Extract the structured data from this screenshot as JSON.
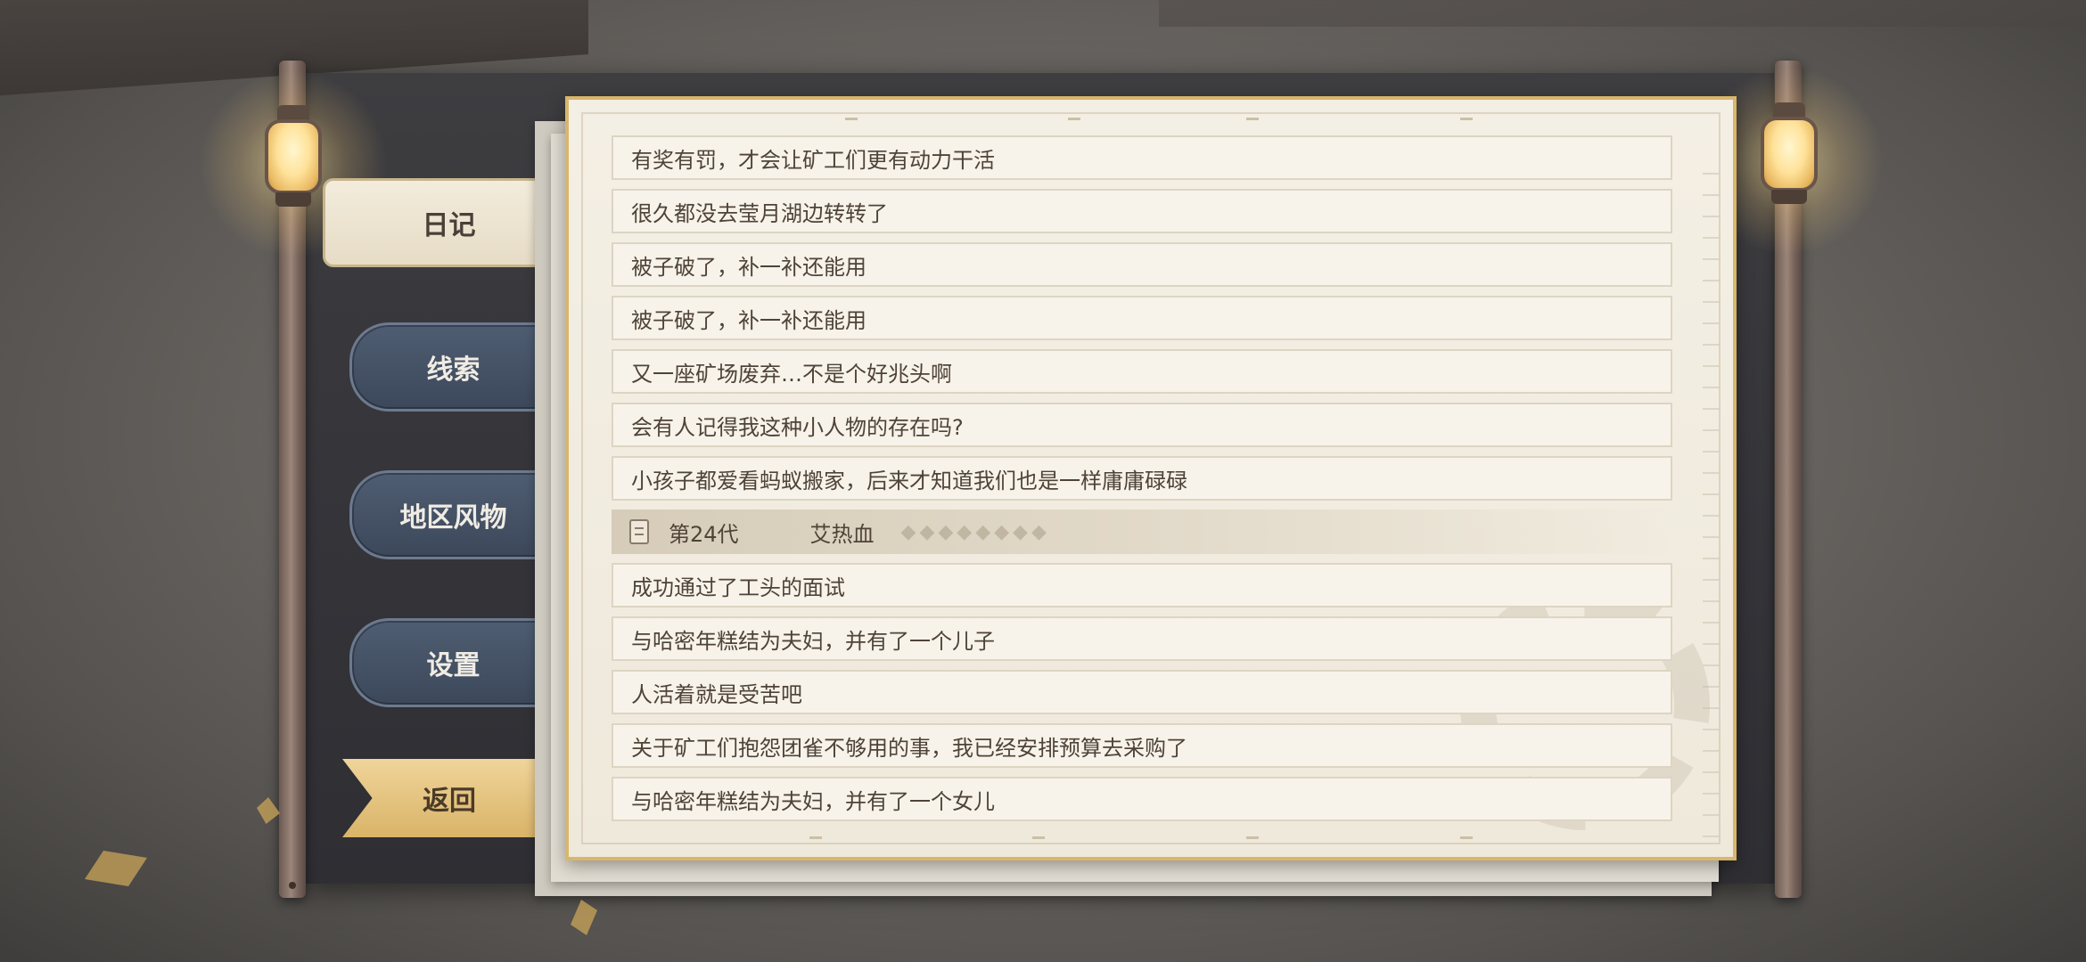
{
  "menu": {
    "diary": "日记",
    "clues": "线索",
    "local_features": "地区风物",
    "settings": "设置",
    "back": "返回"
  },
  "entries_before": [
    "有奖有罚，才会让矿工们更有动力干活",
    "很久都没去莹月湖边转转了",
    "被子破了，补一补还能用",
    "被子破了，补一补还能用",
    "又一座矿场废弃…不是个好兆头啊",
    "会有人记得我这种小人物的存在吗?",
    "小孩子都爱看蚂蚁搬家，后来才知道我们也是一样庸庸碌碌"
  ],
  "generation_header": {
    "generation": "第24代",
    "name": "艾热血",
    "icon": "document-icon"
  },
  "entries_after": [
    "成功通过了工头的面试",
    "与哈密年糕结为夫妇，并有了一个儿子",
    "人活着就是受苦吧",
    "关于矿工们抱怨团雀不够用的事，我已经安排预算去采购了",
    "与哈密年糕结为夫妇，并有了一个女儿"
  ],
  "colors": {
    "menu_dark": "#45526a",
    "menu_active": "#efe7d6",
    "back_gold": "#e3c17a",
    "paper": "#f3eee3",
    "paper_border": "#d8b66c"
  }
}
